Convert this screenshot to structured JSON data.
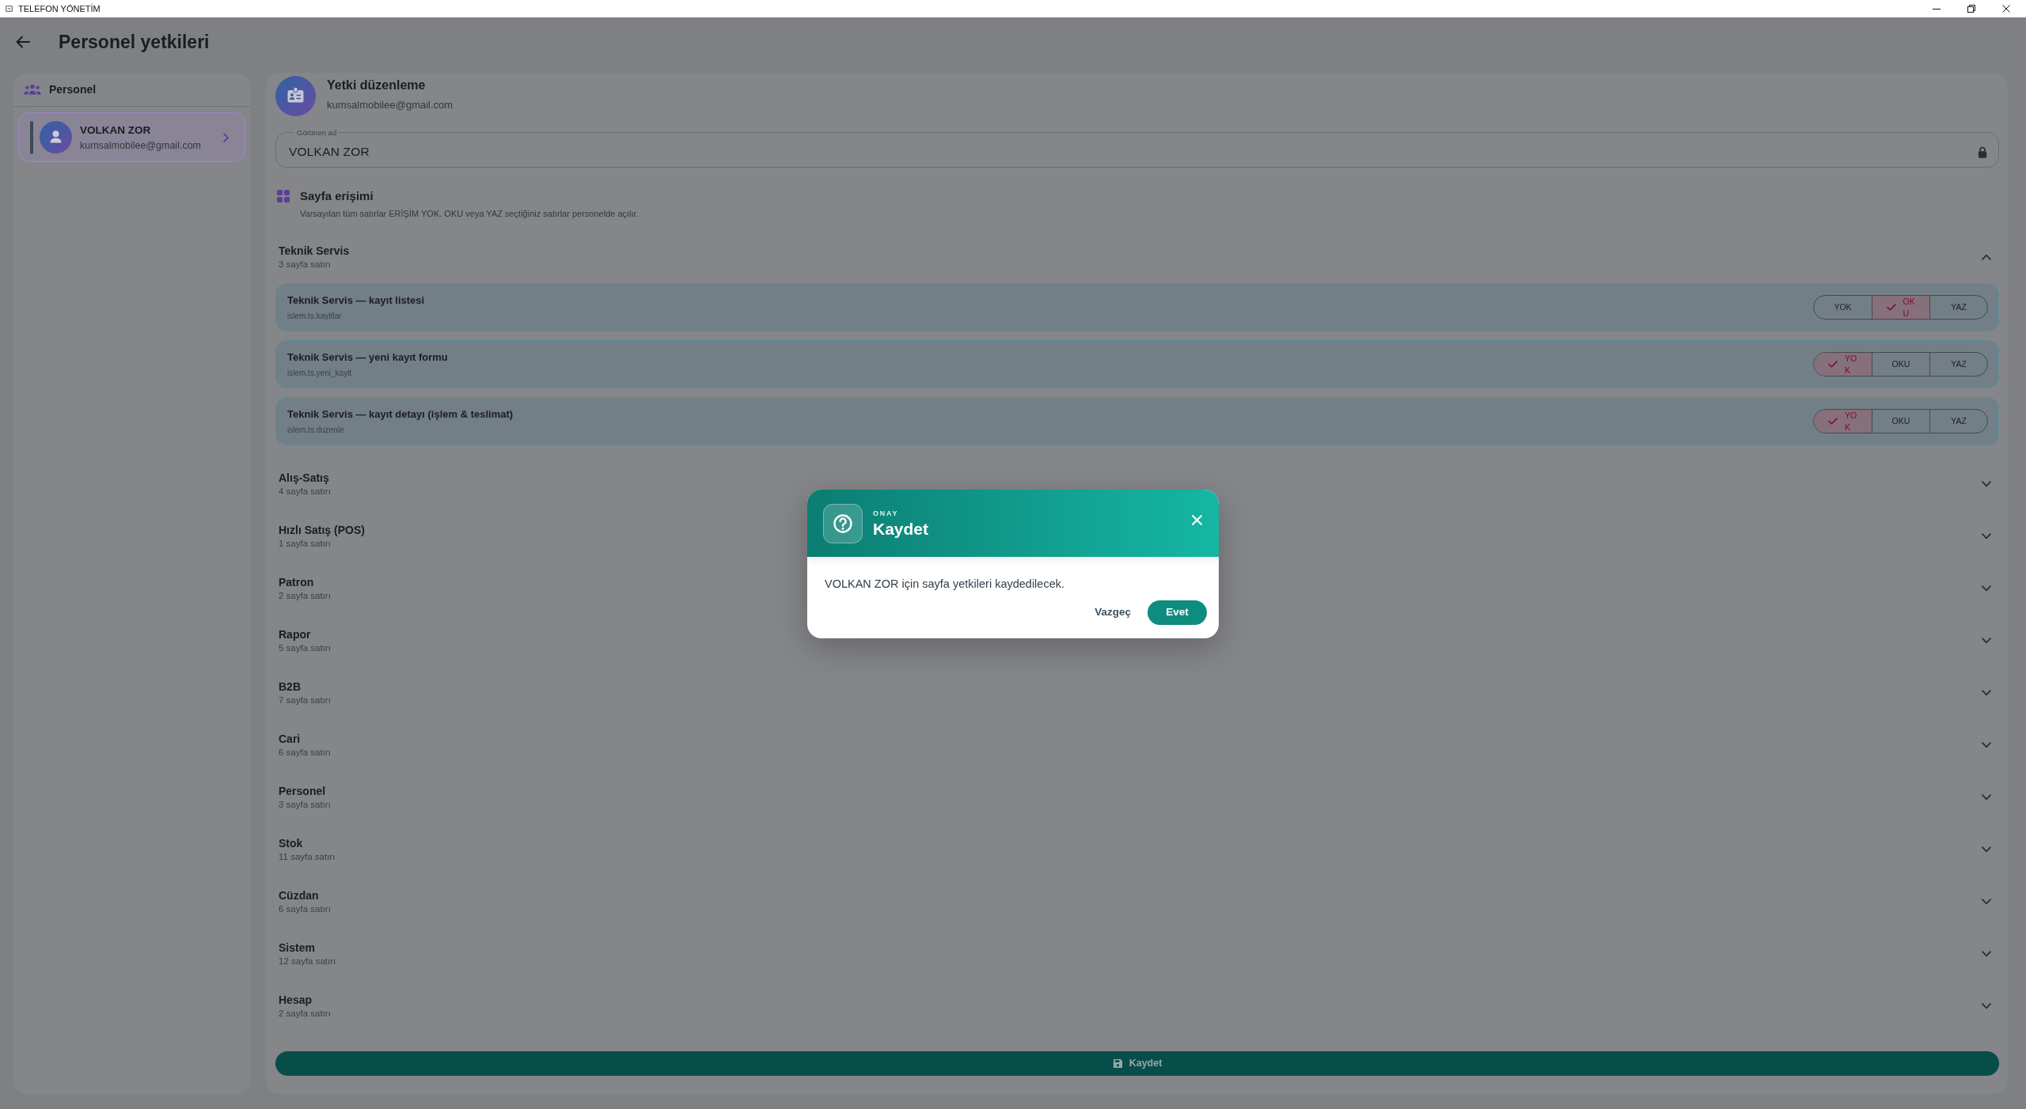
{
  "window": {
    "title": "TELEFON YÖNETİM"
  },
  "header": {
    "title": "Personel yetkileri"
  },
  "sidebar": {
    "title": "Personel",
    "items": [
      {
        "name": "VOLKAN ZOR",
        "email": "kumsalmobilee@gmail.com",
        "selected": true
      }
    ]
  },
  "editor": {
    "title": "Yetki düzenleme",
    "subtitle": "kumsalmobilee@gmail.com",
    "display_name": {
      "label": "Görünen ad",
      "value": "VOLKAN ZOR",
      "locked": true
    },
    "access": {
      "title": "Sayfa erişimi",
      "description": "Varsayılan tüm satırlar ERİŞİM YOK. OKU veya YAZ seçtiğiniz satırlar personelde açılır."
    },
    "groups": [
      {
        "title": "Teknik Servis",
        "count": "3 sayfa satırı",
        "expanded": true,
        "rows": [
          {
            "title": "Teknik Servis — kayıt listesi",
            "key": "islem.ts.kayitlar",
            "options": [
              {
                "label": "YOK",
                "selected": false
              },
              {
                "label": "OKU",
                "selected": true
              },
              {
                "label": "YAZ",
                "selected": false
              }
            ]
          },
          {
            "title": "Teknik Servis — yeni kayıt formu",
            "key": "islem.ts.yeni_kayit",
            "options": [
              {
                "label": "YOK",
                "selected": true
              },
              {
                "label": "OKU",
                "selected": false
              },
              {
                "label": "YAZ",
                "selected": false
              }
            ]
          },
          {
            "title": "Teknik Servis — kayıt detayı (işlem & teslimat)",
            "key": "islem.ts.duzenle",
            "options": [
              {
                "label": "YOK",
                "selected": true
              },
              {
                "label": "OKU",
                "selected": false
              },
              {
                "label": "YAZ",
                "selected": false
              }
            ]
          }
        ]
      },
      {
        "title": "Alış-Satış",
        "count": "4 sayfa satırı",
        "expanded": false
      },
      {
        "title": "Hızlı Satış (POS)",
        "count": "1 sayfa satırı",
        "expanded": false
      },
      {
        "title": "Patron",
        "count": "2 sayfa satırı",
        "expanded": false
      },
      {
        "title": "Rapor",
        "count": "5 sayfa satırı",
        "expanded": false
      },
      {
        "title": "B2B",
        "count": "7 sayfa satırı",
        "expanded": false
      },
      {
        "title": "Cari",
        "count": "6 sayfa satırı",
        "expanded": false
      },
      {
        "title": "Personel",
        "count": "3 sayfa satırı",
        "expanded": false
      },
      {
        "title": "Stok",
        "count": "11 sayfa satırı",
        "expanded": false
      },
      {
        "title": "Cüzdan",
        "count": "6 sayfa satırı",
        "expanded": false
      },
      {
        "title": "Sistem",
        "count": "12 sayfa satırı",
        "expanded": false
      },
      {
        "title": "Hesap",
        "count": "2 sayfa satırı",
        "expanded": false
      }
    ],
    "save_button": {
      "label": "Kaydet"
    }
  },
  "dialog": {
    "eyebrow": "ONAY",
    "title": "Kaydet",
    "message": "VOLKAN ZOR için sayfa yetkileri kaydedilecek.",
    "buttons": [
      {
        "label": "Vazgeç",
        "kind": "text"
      },
      {
        "label": "Evet",
        "kind": "primary"
      }
    ]
  }
}
